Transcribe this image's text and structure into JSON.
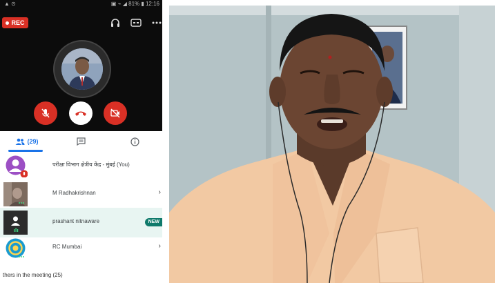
{
  "status_bar": {
    "left": "▲ ⊙",
    "right": "▣ ⌁ ◢ 81% ▮ 12:16"
  },
  "call": {
    "rec_label": "REC",
    "top_icons": [
      "headphones-icon",
      "captions-icon",
      "more-icon"
    ],
    "controls": [
      {
        "name": "mute-button",
        "icon": "mic-off-icon",
        "color": "#d93025"
      },
      {
        "name": "end-call-button",
        "icon": "phone-hangup-icon",
        "color": "#ffffff"
      },
      {
        "name": "camera-off-button",
        "icon": "camera-off-icon",
        "color": "#d93025"
      }
    ]
  },
  "tabs": {
    "people_count": "(29)",
    "items": [
      "people-tab",
      "chat-tab",
      "info-tab"
    ]
  },
  "participants": [
    {
      "name": "परीक्षा विभाग क्षेत्रीय केंद्र - मुंबई (You)"
    },
    {
      "name": "M Radhakrishnan"
    },
    {
      "name": "prashant nitnaware",
      "badge": "NEW"
    },
    {
      "name": "RC Mumbai"
    }
  ],
  "others_label": "thers in the meeting (25)",
  "colors": {
    "accent": "#1a73e8",
    "rec": "#d93025",
    "teal": "#0f7a6b"
  }
}
